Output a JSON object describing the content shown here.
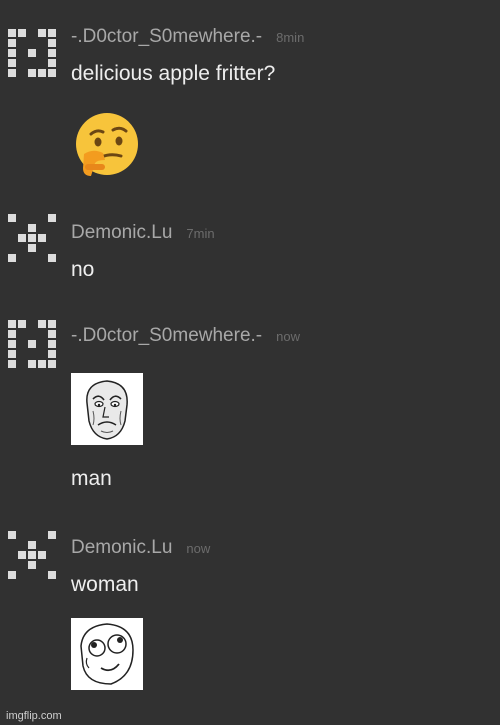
{
  "messages": [
    {
      "username": "-.D0ctor_S0mewhere.-",
      "time": "8min",
      "text": "delicious apple fritter?",
      "emoji": "thinking-face"
    },
    {
      "username": "Demonic.Lu",
      "time": "7min",
      "text": "no"
    },
    {
      "username": "-.D0ctor_S0mewhere.-",
      "time": "now",
      "sticker": "okay-guy-meme",
      "text": "man"
    },
    {
      "username": "Demonic.Lu",
      "time": "now",
      "text": "woman",
      "sticker": "derp-face-meme"
    }
  ],
  "watermark": "imgflip.com",
  "colors": {
    "background": "#313131",
    "username": "#a8a8a8",
    "timestamp": "#6c6c6c",
    "text": "#eeeeee",
    "avatar": "#dddddd"
  }
}
